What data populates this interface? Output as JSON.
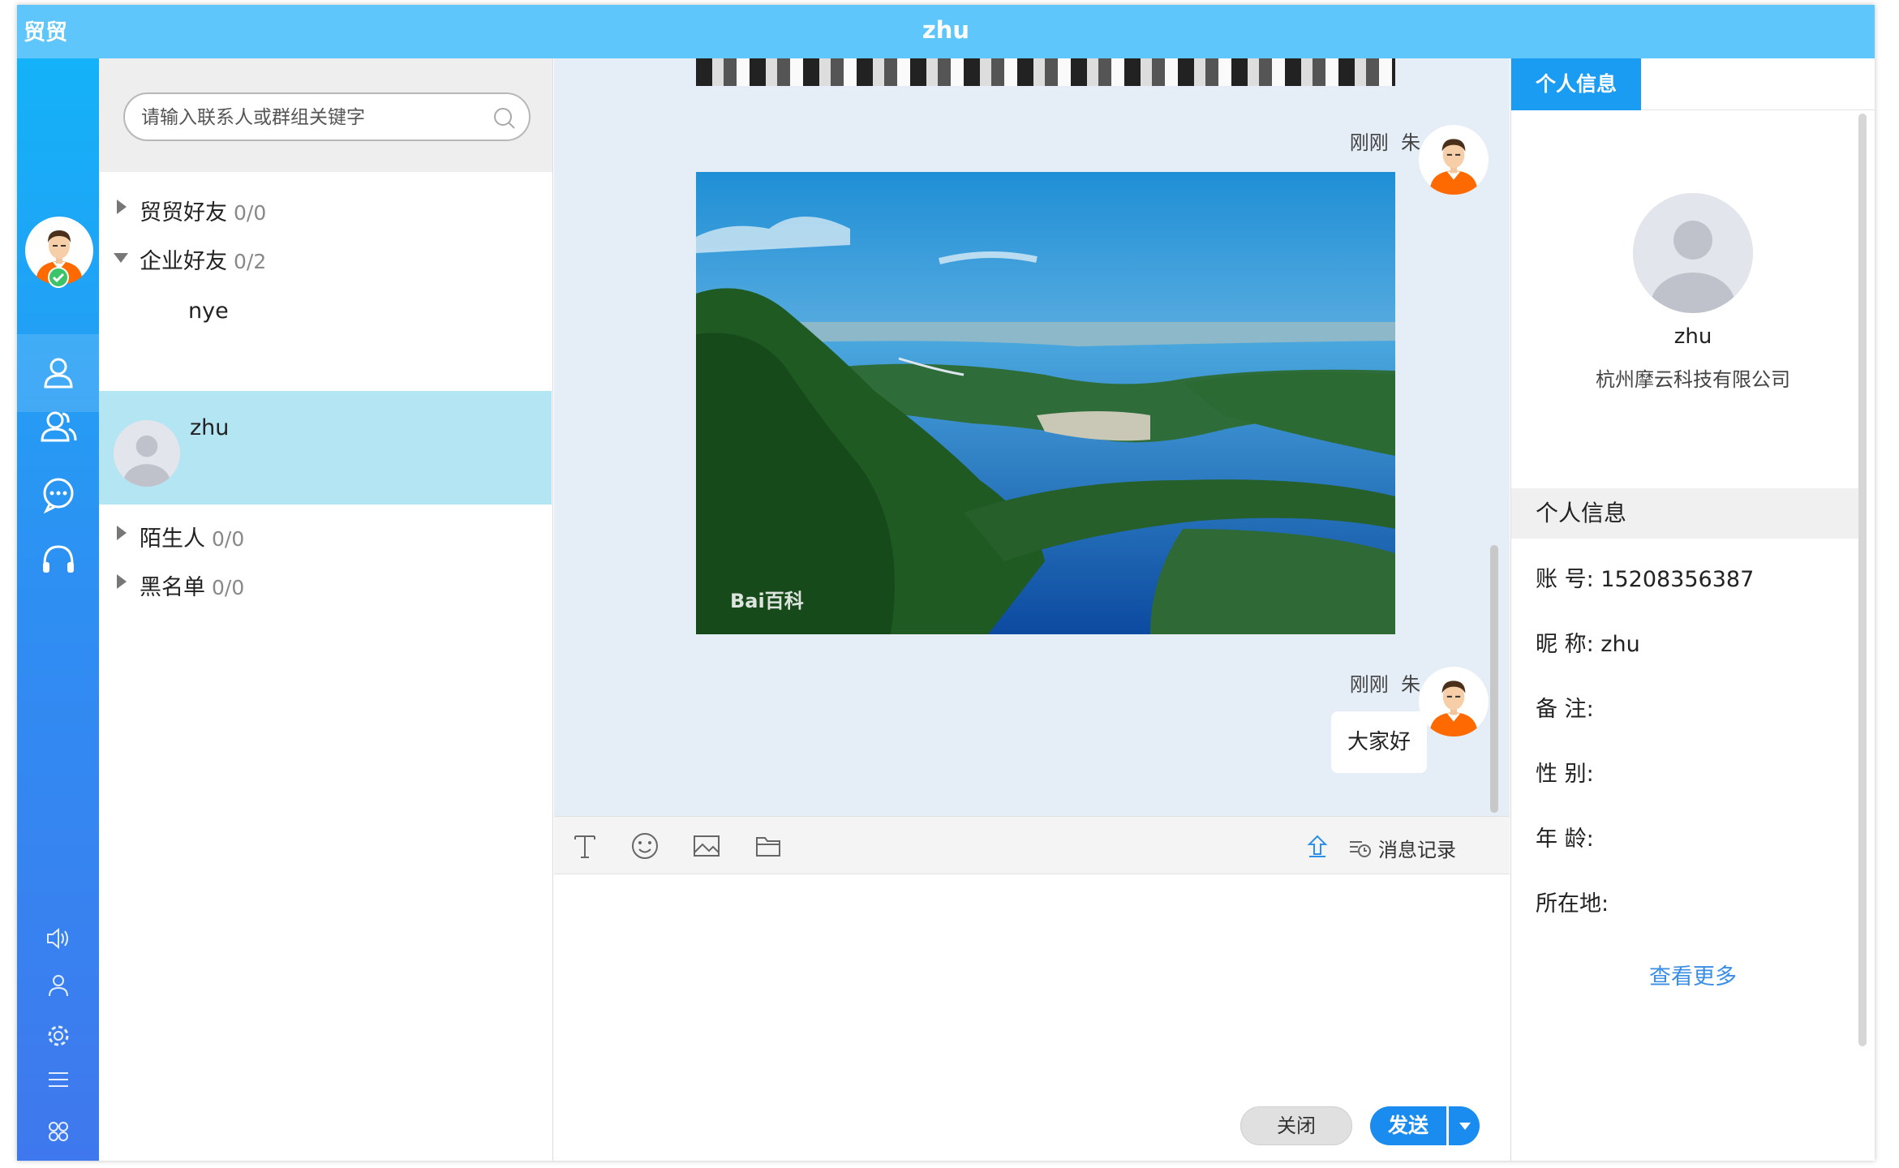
{
  "app": {
    "name": "贸贸",
    "window_title": "zhu"
  },
  "search": {
    "placeholder": "请输入联系人或群组关键字"
  },
  "contacts": {
    "groups": [
      {
        "name": "贸贸好友",
        "count": "0/0",
        "expanded": false
      },
      {
        "name": "企业好友",
        "count": "0/2",
        "expanded": true
      },
      {
        "name": "陌生人",
        "count": "0/0",
        "expanded": false
      },
      {
        "name": "黑名单",
        "count": "0/0",
        "expanded": false
      }
    ],
    "members": [
      {
        "name": "nye"
      },
      {
        "name": "zhu",
        "selected": true
      }
    ]
  },
  "chat": {
    "messages": [
      {
        "time": "刚刚",
        "sender": "朱",
        "type": "image",
        "watermark": "Bai百科"
      },
      {
        "time": "刚刚",
        "sender": "朱",
        "type": "text",
        "text": "大家好"
      }
    ],
    "history_label": "消息记录",
    "close_label": "关闭",
    "send_label": "发送"
  },
  "profile": {
    "tab_label": "个人信息",
    "name": "zhu",
    "company": "杭州摩云科技有限公司",
    "section_title": "个人信息",
    "fields": [
      {
        "label": "账 号:",
        "value": "15208356387"
      },
      {
        "label": "昵 称:",
        "value": "zhu"
      },
      {
        "label": "备 注:",
        "value": ""
      },
      {
        "label": "性 别:",
        "value": ""
      },
      {
        "label": "年 龄:",
        "value": ""
      },
      {
        "label": "所在地:",
        "value": ""
      }
    ],
    "see_more": "查看更多"
  },
  "colors": {
    "titlebar": "#5ec6fa",
    "accent": "#1a8cf0",
    "selected_row": "#b3e5f2"
  }
}
